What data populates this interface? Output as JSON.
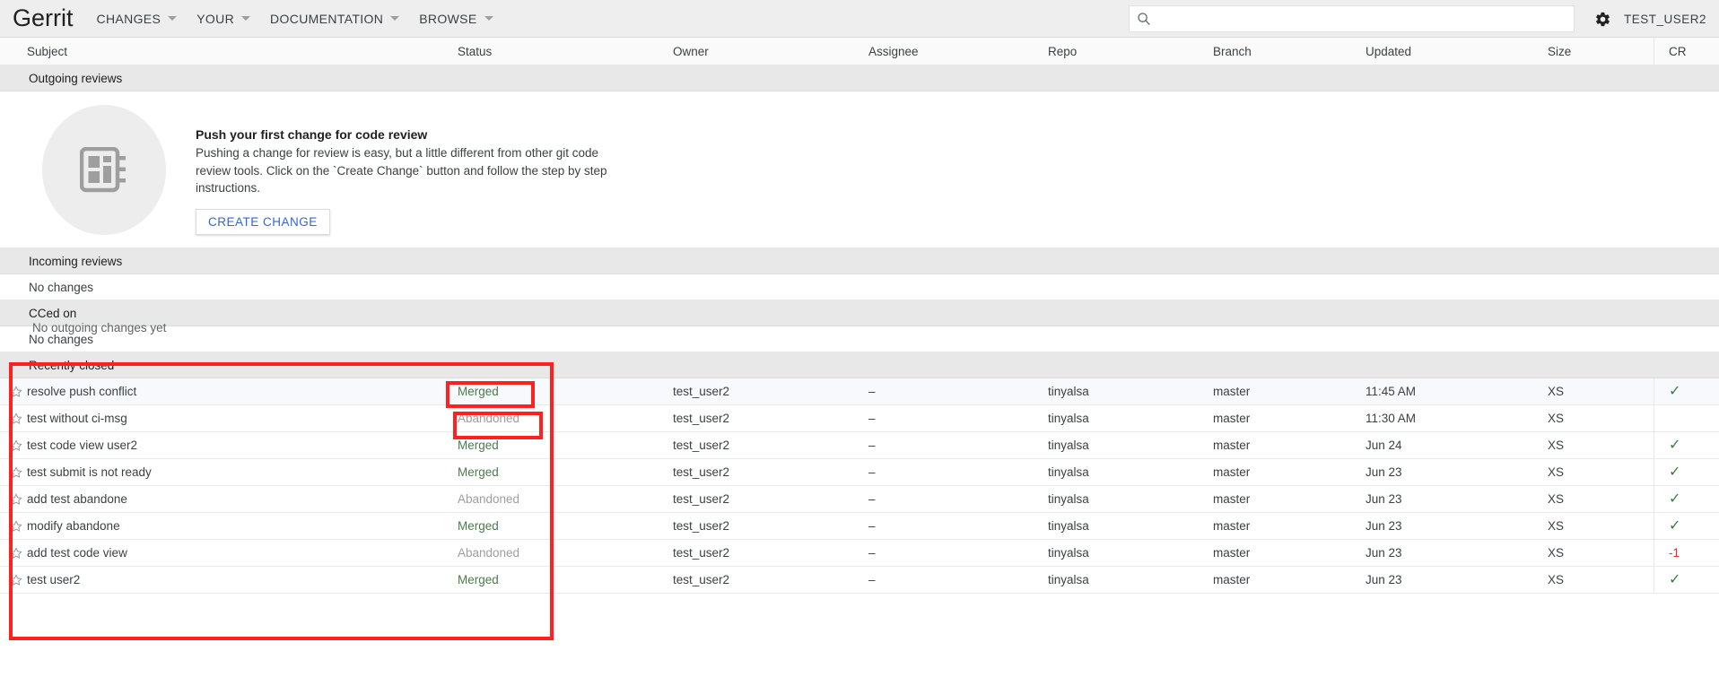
{
  "header": {
    "logo": "Gerrit",
    "nav": [
      {
        "label": "CHANGES",
        "icon": "chevron-down-icon"
      },
      {
        "label": "YOUR",
        "icon": "chevron-down-icon"
      },
      {
        "label": "DOCUMENTATION",
        "icon": "chevron-down-icon"
      },
      {
        "label": "BROWSE",
        "icon": "chevron-down-icon"
      }
    ],
    "search": {
      "value": "",
      "placeholder": "",
      "icon": "search-icon"
    },
    "settings_icon": "gear-icon",
    "username": "TEST_USER2"
  },
  "columns": {
    "subject": "Subject",
    "status": "Status",
    "owner": "Owner",
    "assignee": "Assignee",
    "repo": "Repo",
    "branch": "Branch",
    "updated": "Updated",
    "size": "Size",
    "cr": "CR"
  },
  "sections": {
    "outgoing": "Outgoing reviews",
    "incoming": "Incoming reviews",
    "cced": "CCed on",
    "recently_closed": "Recently closed",
    "no_changes": "No changes"
  },
  "empty_state": {
    "caption": "No outgoing changes yet",
    "title": "Push your first change for code review",
    "body": "Pushing a change for review is easy, but a little different from other git code review tools. Click on the `Create Change` button and follow the step by step instructions.",
    "button": "CREATE CHANGE",
    "icon": "notebook-icon"
  },
  "rows": [
    {
      "star": "star-outline-icon",
      "subject": "resolve push conflict",
      "status": "Merged",
      "status_kind": "merged",
      "owner": "test_user2",
      "assignee": "–",
      "repo": "tinyalsa",
      "branch": "master",
      "updated": "11:45 AM",
      "size": "XS",
      "cr": "✓",
      "cr_kind": "plus"
    },
    {
      "star": "star-outline-icon",
      "subject": "test without ci-msg",
      "status": "Abandoned",
      "status_kind": "abandoned",
      "owner": "test_user2",
      "assignee": "–",
      "repo": "tinyalsa",
      "branch": "master",
      "updated": "11:30 AM",
      "size": "XS",
      "cr": "",
      "cr_kind": "none"
    },
    {
      "star": "star-outline-icon",
      "subject": "test code view user2",
      "status": "Merged",
      "status_kind": "merged",
      "owner": "test_user2",
      "assignee": "–",
      "repo": "tinyalsa",
      "branch": "master",
      "updated": "Jun 24",
      "size": "XS",
      "cr": "✓",
      "cr_kind": "plus"
    },
    {
      "star": "star-outline-icon",
      "subject": "test submit is not ready",
      "status": "Merged",
      "status_kind": "merged",
      "owner": "test_user2",
      "assignee": "–",
      "repo": "tinyalsa",
      "branch": "master",
      "updated": "Jun 23",
      "size": "XS",
      "cr": "✓",
      "cr_kind": "plus"
    },
    {
      "star": "star-outline-icon",
      "subject": "add test abandone",
      "status": "Abandoned",
      "status_kind": "abandoned",
      "owner": "test_user2",
      "assignee": "–",
      "repo": "tinyalsa",
      "branch": "master",
      "updated": "Jun 23",
      "size": "XS",
      "cr": "✓",
      "cr_kind": "plus"
    },
    {
      "star": "star-outline-icon",
      "subject": "modify abandone",
      "status": "Merged",
      "status_kind": "merged",
      "owner": "test_user2",
      "assignee": "–",
      "repo": "tinyalsa",
      "branch": "master",
      "updated": "Jun 23",
      "size": "XS",
      "cr": "✓",
      "cr_kind": "plus"
    },
    {
      "star": "star-outline-icon",
      "subject": "add test code view",
      "status": "Abandoned",
      "status_kind": "abandoned",
      "owner": "test_user2",
      "assignee": "–",
      "repo": "tinyalsa",
      "branch": "master",
      "updated": "Jun 23",
      "size": "XS",
      "cr": "-1",
      "cr_kind": "minus"
    },
    {
      "star": "star-outline-icon",
      "subject": "test user2",
      "status": "Merged",
      "status_kind": "merged",
      "owner": "test_user2",
      "assignee": "–",
      "repo": "tinyalsa",
      "branch": "master",
      "updated": "Jun 23",
      "size": "XS",
      "cr": "✓",
      "cr_kind": "plus"
    }
  ],
  "colors": {
    "merged": "#4d7b4d",
    "abandoned": "#9e9e9e",
    "cr_positive": "#3a7d44",
    "cr_negative": "#d93025",
    "annotation": "#ff2020",
    "link": "#3367d6"
  }
}
